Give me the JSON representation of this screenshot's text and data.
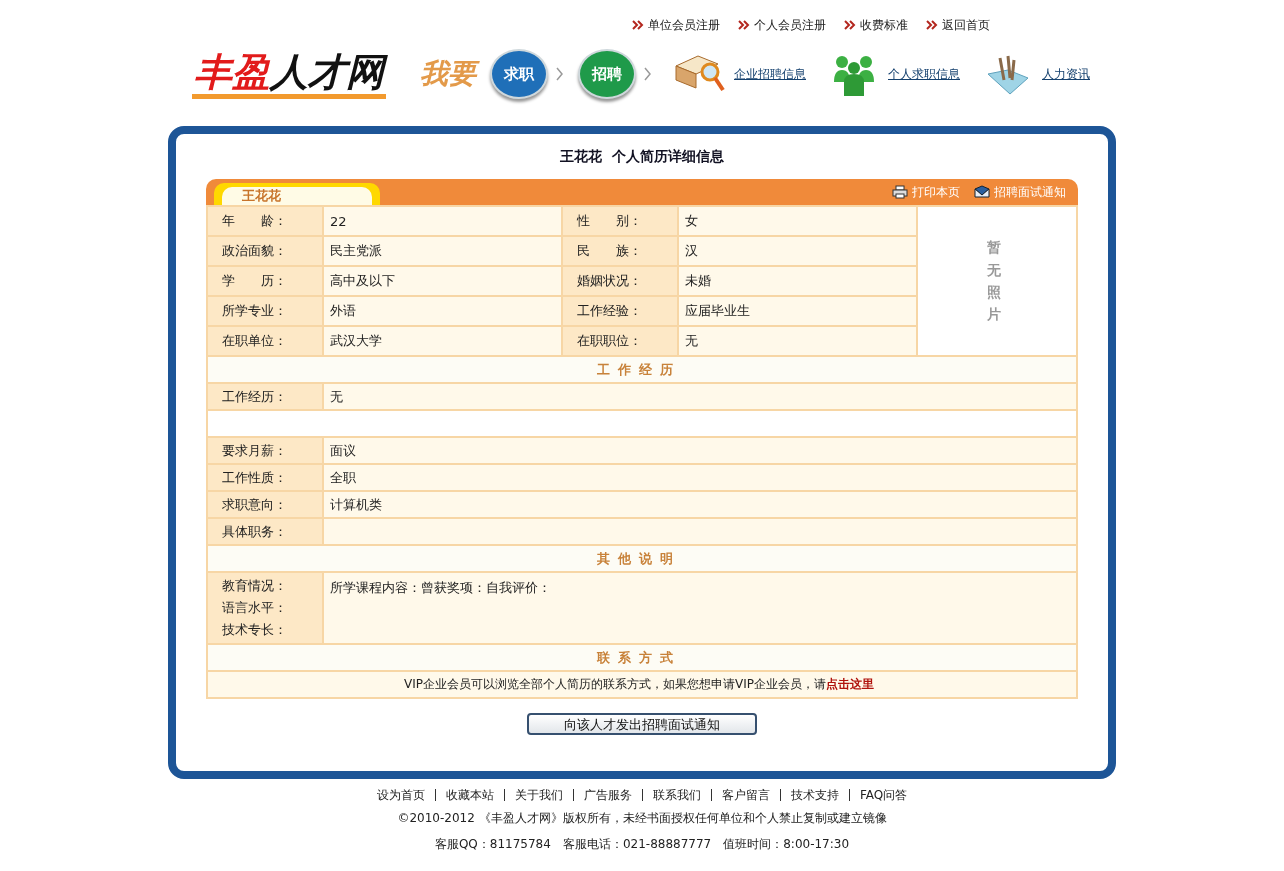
{
  "top_nav": [
    "单位会员注册",
    "个人会员注册",
    "收费标准",
    "返回首页"
  ],
  "logo": {
    "text_1": "丰盈",
    "text_2": "人才网"
  },
  "slogan": "我要",
  "pills": [
    {
      "label": "求职",
      "color": "#1f6fb8"
    },
    {
      "label": "招聘",
      "color": "#1f9a4a"
    }
  ],
  "quick_links": [
    {
      "label": "企业招聘信息",
      "kind": "book"
    },
    {
      "label": "个人求职信息",
      "kind": "people"
    },
    {
      "label": "人力资讯",
      "kind": "tools"
    }
  ],
  "resume": {
    "title": "王花花  个人简历详细信息",
    "tab": "王花花",
    "actions": [
      {
        "label": "打印本页",
        "kind": "print"
      },
      {
        "label": "招聘面试通知",
        "kind": "notify"
      }
    ],
    "basic": [
      {
        "label": "年　　龄：",
        "value": "22",
        "label_2": "性　　别：",
        "value_2": "女"
      },
      {
        "label": "政治面貌：",
        "value": "民主党派",
        "label_2": "民　　族：",
        "value_2": "汉"
      },
      {
        "label": "学　　历：",
        "value": "高中及以下",
        "label_2": "婚姻状况：",
        "value_2": "未婚"
      },
      {
        "label": "所学专业：",
        "value": "外语",
        "label_2": "工作经验：",
        "value_2": "应届毕业生"
      },
      {
        "label": "在职单位：",
        "value": "武汉大学",
        "label_2": "在职职位：",
        "value_2": "无"
      }
    ],
    "photo": "暂无照片",
    "sections": [
      {
        "kind": "heading",
        "text": "工作经历"
      },
      {
        "kind": "field",
        "label": "工作经历：",
        "value": "无"
      },
      {
        "kind": "blank"
      },
      {
        "kind": "field",
        "label": "要求月薪：",
        "value": "面议"
      },
      {
        "kind": "field",
        "label": "工作性质：",
        "value": "全职"
      },
      {
        "kind": "field",
        "label": "求职意向：",
        "value": "计算机类"
      },
      {
        "kind": "field",
        "label": "具体职务："
      },
      {
        "kind": "heading",
        "text": "其他说明"
      },
      {
        "kind": "multi",
        "labels": [
          "教育情况：",
          "语言水平：",
          "技术专长："
        ],
        "value": "所学课程内容：曾获奖项：自我评价："
      },
      {
        "kind": "heading",
        "text": "联系方式"
      },
      {
        "kind": "note",
        "text": "VIP企业会员可以浏览全部个人简历的联系方式，如果您想申请VIP企业会员，请",
        "link": "点击这里"
      }
    ],
    "button": "向该人才发出招聘面试通知"
  },
  "footer": {
    "links": [
      "设为首页",
      "收藏本站",
      "关于我们",
      "广告服务",
      "联系我们",
      "客户留言",
      "技术支持",
      "FAQ问答"
    ],
    "copyright": "©2010-2012 《丰盈人才网》版权所有，未经书面授权任何单位和个人禁止复制或建立镜像",
    "contact": "客服QQ：81175784　客服电话：021-88887777　值班时间：8:00-17:30"
  }
}
